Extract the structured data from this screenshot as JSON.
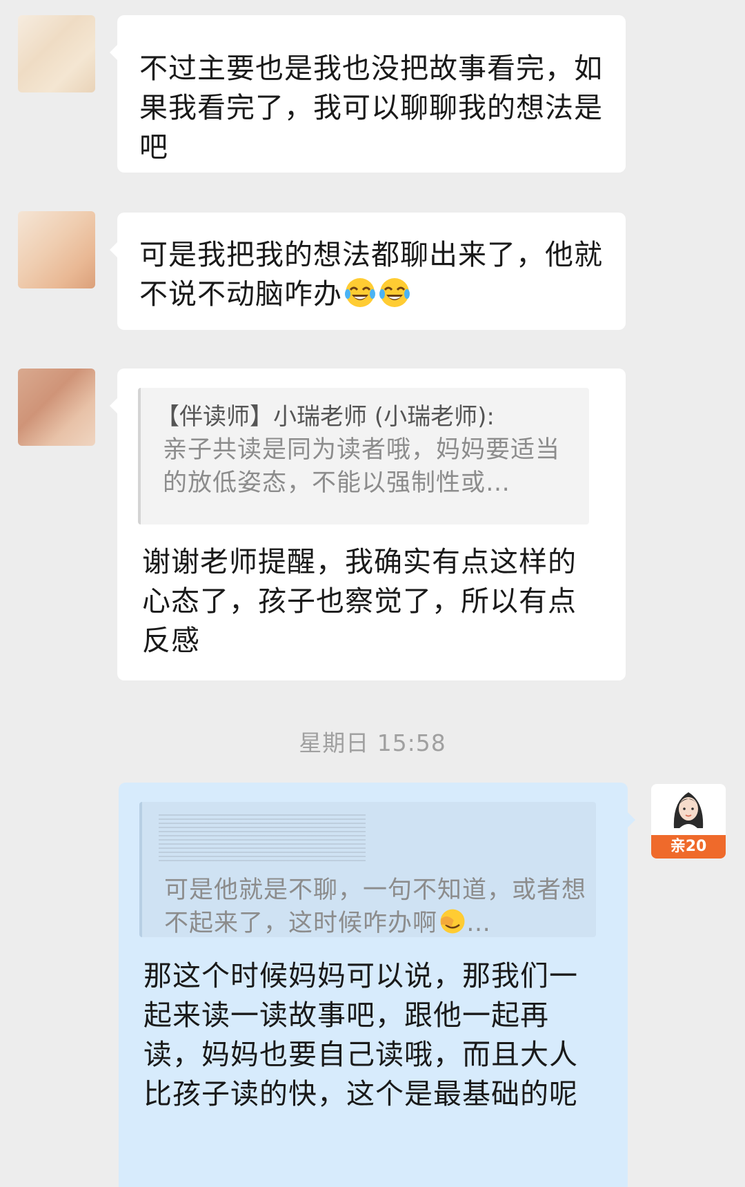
{
  "messages": [
    {
      "sender": "other",
      "text": "不过主要也是我也没把故事看完，如果我看完了，我可以聊聊我的想法是吧"
    },
    {
      "sender": "other",
      "text": "可是我把我的想法都聊出来了，他就不说不动脑咋办",
      "emojis": [
        "laughing-tears-emoji",
        "laughing-tears-emoji"
      ]
    },
    {
      "sender": "other",
      "quote": {
        "author": "【伴读师】小瑞老师 (小瑞老师):",
        "text": "亲子共读是同为读者哦，妈妈要适当的放低姿态，不能以强制性或…"
      },
      "text": "谢谢老师提醒，我确实有点这样的心态了，孩子也察觉了，所以有点反感"
    },
    {
      "sender": "me",
      "quote": {
        "text": "可是他就是不聊，一句不知道，或者想不起来了，这时候咋办啊",
        "trailing": "…"
      },
      "text": "那这个时候妈妈可以说，那我们一起来读一读故事吧，跟他一起再读，妈妈也要自己读哦，而且大人比孩子读的快，这个是最基础的呢"
    }
  ],
  "timestamp": "星期日 15:58",
  "my_avatar": {
    "badge": "亲20"
  },
  "colors": {
    "background": "#ededed",
    "incoming_bubble": "#ffffff",
    "outgoing_bubble": "#d7ebfc",
    "badge": "#ef6a2b"
  }
}
